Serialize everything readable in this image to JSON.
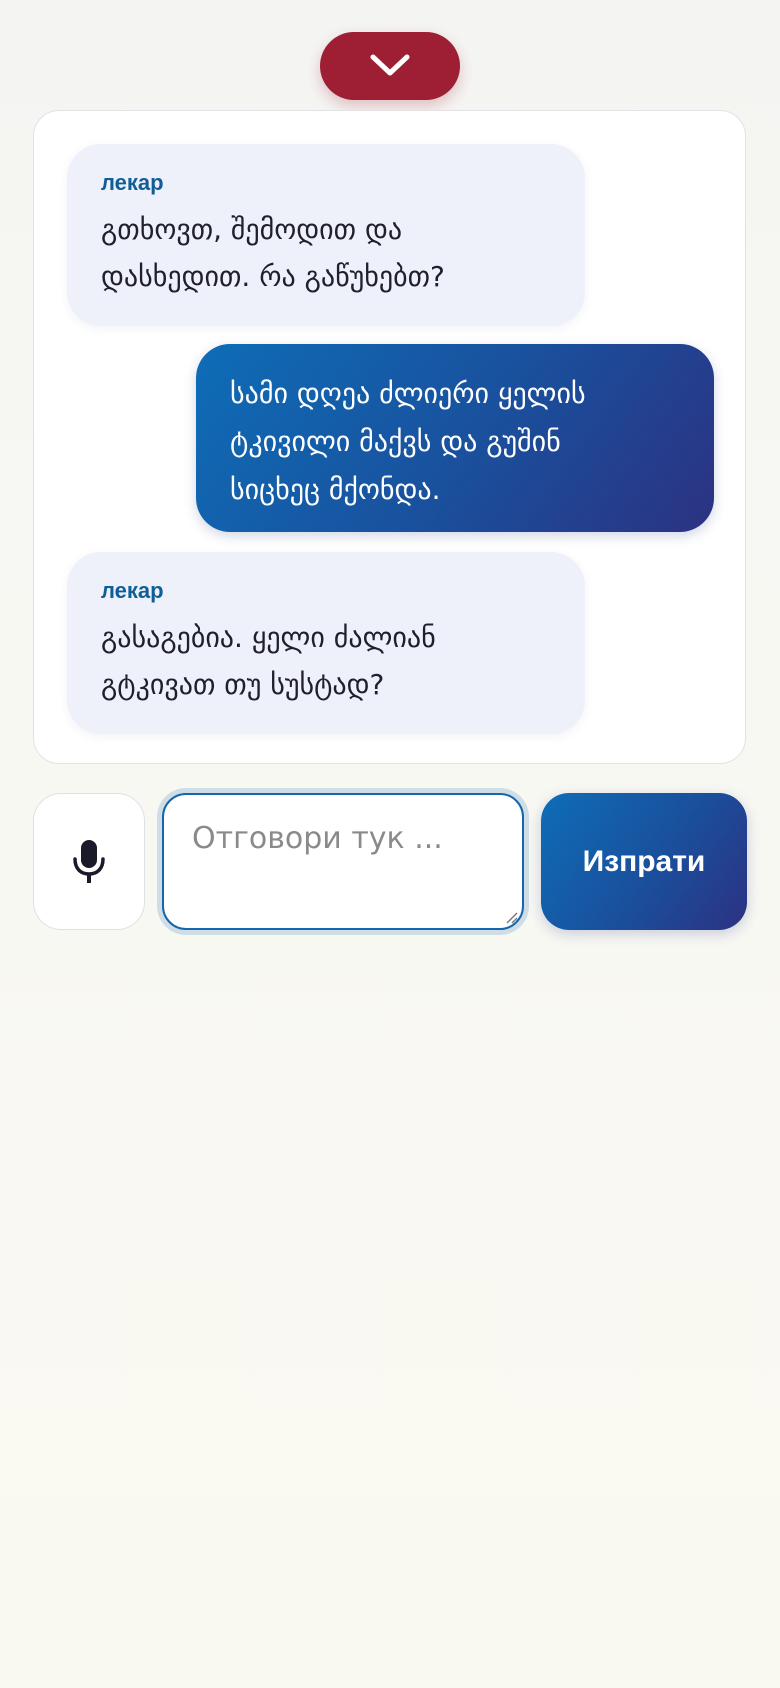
{
  "header": {
    "collapse_icon": "chevron-down-icon"
  },
  "colors": {
    "accent_red": "#9e1f33",
    "brand_blue": "#1466ad",
    "bubble_bot_bg": "#eef0fa",
    "speaker_label": "#0f5e96"
  },
  "chat": {
    "messages": [
      {
        "role": "bot",
        "speaker": "лекар",
        "lines": [
          "გთხოვთ, შემოდით და",
          "დასხედით. რა გაწუხებთ?"
        ]
      },
      {
        "role": "user",
        "lines": [
          "სამი დღეა ძლიერი ყელის",
          "ტკივილი მაქვს და გუშინ",
          "სიცხეც მქონდა."
        ]
      },
      {
        "role": "bot",
        "speaker": "лекар",
        "lines": [
          "გასაგებია. ყელი ძალიან",
          "გტკივათ თუ სუსტად?"
        ]
      }
    ]
  },
  "composer": {
    "mic_icon": "microphone-icon",
    "placeholder": "Отговори тук ...",
    "value": "",
    "send_label": "Изпрати"
  }
}
